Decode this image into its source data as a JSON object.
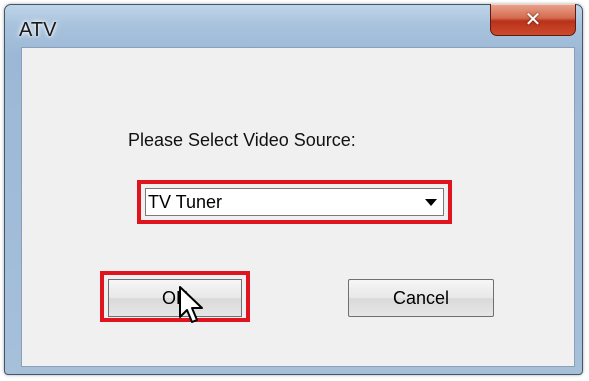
{
  "window": {
    "title": "ATV",
    "close_symbol": "✕"
  },
  "dialog": {
    "prompt": "Please Select Video Source:",
    "video_source": {
      "selected": "TV Tuner"
    },
    "ok_label": "OK",
    "cancel_label": "Cancel"
  },
  "colors": {
    "highlight": "#e0141e",
    "close_button": "#c94a2e",
    "titlebar": "#a9c3dd"
  },
  "icons": {
    "close": "close-icon",
    "dropdown": "chevron-down-icon",
    "cursor": "mouse-pointer-icon"
  }
}
